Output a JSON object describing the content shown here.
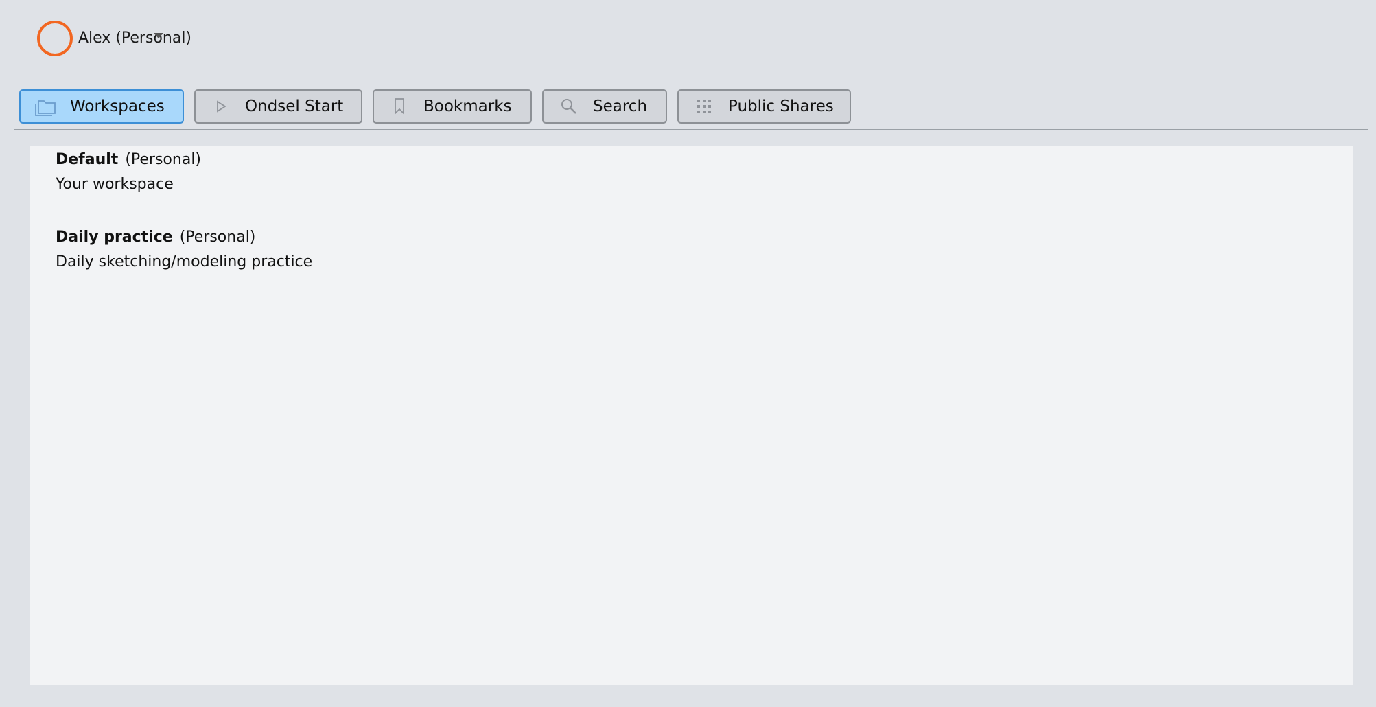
{
  "account": {
    "name": "Alex (Personal)",
    "avatar_color": "#f26722",
    "caret_icon": "chevron-down-icon"
  },
  "tabs": [
    {
      "label": "Workspaces",
      "icon": "folder-icon",
      "active": true
    },
    {
      "label": "Ondsel Start",
      "icon": "play-icon",
      "active": false
    },
    {
      "label": "Bookmarks",
      "icon": "bookmark-icon",
      "active": false
    },
    {
      "label": "Search",
      "icon": "search-icon",
      "active": false
    },
    {
      "label": "Public Shares",
      "icon": "grid-icon",
      "active": false
    }
  ],
  "workspaces": [
    {
      "name": "Default",
      "type": "(Personal)",
      "description": "Your workspace"
    },
    {
      "name": "Daily practice",
      "type": "(Personal)",
      "description": "Daily sketching/modeling practice"
    }
  ],
  "colors": {
    "background": "#dfe2e7",
    "panel": "#f2f3f5",
    "active_tab": "#a9d8fb",
    "active_tab_border": "#3d8fd6",
    "tab": "#d3d6db"
  }
}
